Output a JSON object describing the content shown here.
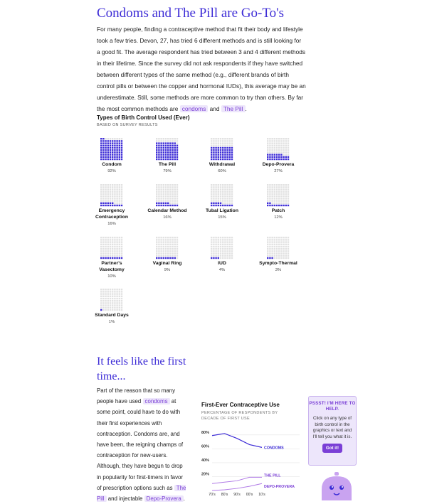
{
  "section1": {
    "heading": "Condoms and The Pill are Go-To's",
    "intro_text": "For many people, finding a contraceptive method that fit their body and lifestyle took a few tries. Devon, 27, has tried 6 different methods and is still looking for a good fit. The average respondent has tried between 3 and 4 different methods in their lifetime. Since the survey did not ask respondents if they have switched between different types of the same method (e.g., different brands of birth control pills or between the copper and hormonal IUDs), this average may be an underestimate. Still, some methods are more common to try than others. By far the most common methods are",
    "link_condoms": "condoms",
    "joiner": "and",
    "link_pill": "The Pill",
    "end_punct": "."
  },
  "colors": {
    "accent": "#3d2cd6",
    "empty_dot": "#e1e1e1",
    "highlight_bg": "#ede6fb",
    "highlight_text": "#7a3fd6",
    "line": "#3d2cd6",
    "line_light": "#b07ae6"
  },
  "chart_data": [
    {
      "type": "waffle",
      "title": "Types of Birth Control Used (Ever)",
      "subtitle": "BASED ON SURVEY RESULTS",
      "items": [
        {
          "label": "Condom",
          "pct_label": "92%",
          "value": 92
        },
        {
          "label": "The Pill",
          "pct_label": "79%",
          "value": 79
        },
        {
          "label": "Withdrawal",
          "pct_label": "60%",
          "value": 60
        },
        {
          "label": "Depo-Provera",
          "pct_label": "27%",
          "value": 27
        },
        {
          "label": "Emergency Contraception",
          "pct_label": "16%",
          "value": 16
        },
        {
          "label": "Calendar Method",
          "pct_label": "16%",
          "value": 16
        },
        {
          "label": "Tubal Ligation",
          "pct_label": "15%",
          "value": 15
        },
        {
          "label": "Patch",
          "pct_label": "12%",
          "value": 12
        },
        {
          "label": "Partner's Vasectomy",
          "pct_label": "10%",
          "value": 10
        },
        {
          "label": "Vaginal Ring",
          "pct_label": "9%",
          "value": 9
        },
        {
          "label": "IUD",
          "pct_label": "4%",
          "value": 4
        },
        {
          "label": "Sympto-Thermal",
          "pct_label": "3%",
          "value": 3
        },
        {
          "label": "Standard Days",
          "pct_label": "1%",
          "value": 1
        }
      ]
    },
    {
      "type": "line",
      "title": "First-Ever Contraceptive Use",
      "subtitle": "PERCENTAGE OF RESPONDENTS BY DECADE OF FIRST USE",
      "x": [
        "70's",
        "80's",
        "90's",
        "00's",
        "10's"
      ],
      "y_ticks": [
        "80%",
        "60%",
        "40%",
        "20%"
      ],
      "ylim": [
        0,
        90
      ],
      "series": [
        {
          "name": "CONDOMS",
          "values": [
            79,
            82,
            75,
            66,
            62
          ]
        },
        {
          "name": "THE PILL",
          "values": [
            10,
            12,
            14,
            19,
            19
          ]
        },
        {
          "name": "DEPO-PROVERA",
          "values": [
            0,
            1,
            3,
            6,
            10
          ]
        }
      ]
    }
  ],
  "section2": {
    "heading": "It feels like the first time...",
    "text_before": "Part of the reason that so many people have used",
    "link_condoms": "condoms",
    "text_mid": "at some point, could have to do with their first experiences with contraception. Condoms are, and have been, the reigning champs of contraception for new-users. Although, they have begun to drop in popularity for first-timers in favor of prescription options such as",
    "link_pill": "The Pill",
    "joiner": "and injectable",
    "link_depo": "Depo-Provera",
    "end_punct": "."
  },
  "help_box": {
    "title": "PSSST! I'M HERE TO HELP.",
    "body": "Click on any type of birth control in the graphics or text and I'll tell you what it is.",
    "button": "Got it!"
  }
}
